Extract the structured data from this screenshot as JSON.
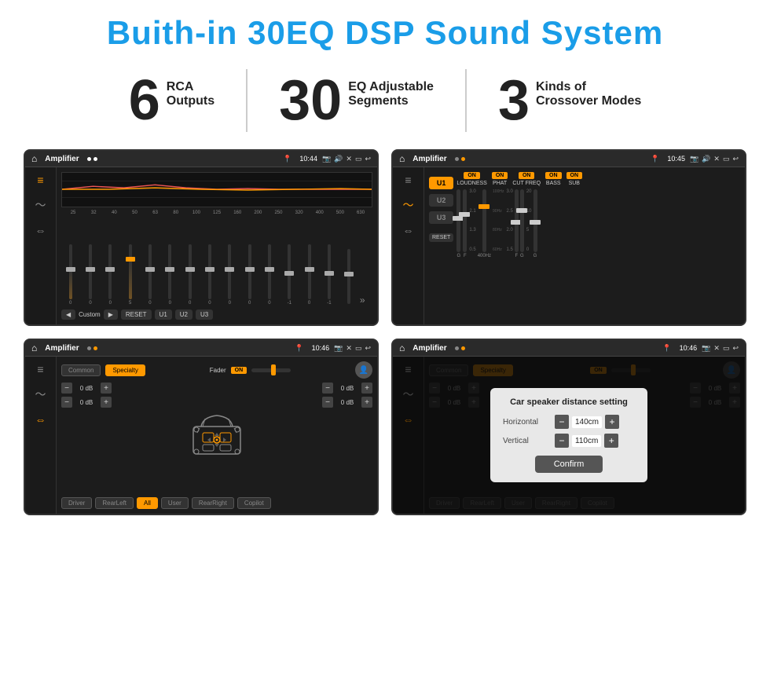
{
  "page": {
    "title": "Buith-in 30EQ DSP Sound System",
    "stats": [
      {
        "number": "6",
        "line1": "RCA",
        "line2": "Outputs"
      },
      {
        "number": "30",
        "line1": "EQ Adjustable",
        "line2": "Segments"
      },
      {
        "number": "3",
        "line1": "Kinds of",
        "line2": "Crossover Modes"
      }
    ]
  },
  "screen1": {
    "app": "Amplifier",
    "time": "10:44",
    "preset": "Custom",
    "freqs": [
      "25",
      "32",
      "40",
      "50",
      "63",
      "80",
      "100",
      "125",
      "160",
      "200",
      "250",
      "320",
      "400",
      "500",
      "630"
    ],
    "values": [
      "0",
      "0",
      "0",
      "5",
      "0",
      "0",
      "0",
      "0",
      "0",
      "0",
      "0",
      "-1",
      "0",
      "-1",
      ""
    ],
    "buttons": [
      "◀",
      "Custom",
      "▶",
      "RESET",
      "U1",
      "U2",
      "U3"
    ]
  },
  "screen2": {
    "app": "Amplifier",
    "time": "10:45",
    "channels": [
      "U1",
      "U2",
      "U3"
    ],
    "controls": [
      "LOUDNESS",
      "PHAT",
      "CUT FREQ",
      "BASS",
      "SUB"
    ],
    "resetBtn": "RESET"
  },
  "screen3": {
    "app": "Amplifier",
    "time": "10:46",
    "modes": [
      "Common",
      "Specialty"
    ],
    "faderLabel": "Fader",
    "faderOnLabel": "ON",
    "dbValues": [
      "0 dB",
      "0 dB",
      "0 dB",
      "0 dB"
    ],
    "bottomBtns": [
      "Driver",
      "RearLeft",
      "All",
      "User",
      "RearRight",
      "Copilot"
    ]
  },
  "screen4": {
    "app": "Amplifier",
    "time": "10:46",
    "modes": [
      "Common",
      "Specialty"
    ],
    "faderOnLabel": "ON",
    "dialog": {
      "title": "Car speaker distance setting",
      "horizontalLabel": "Horizontal",
      "horizontalValue": "140cm",
      "verticalLabel": "Vertical",
      "verticalValue": "110cm",
      "confirmBtn": "Confirm"
    },
    "bottomBtns": [
      "Driver",
      "RearLeft",
      "All",
      "User",
      "RearRight",
      "Copilot"
    ]
  },
  "icons": {
    "home": "⌂",
    "pin": "📍",
    "camera": "📷",
    "speaker": "🔊",
    "back": "↩",
    "equalizer": "≡",
    "wave": "〜",
    "arrows": "⇔",
    "expand": "»",
    "person": "👤"
  }
}
